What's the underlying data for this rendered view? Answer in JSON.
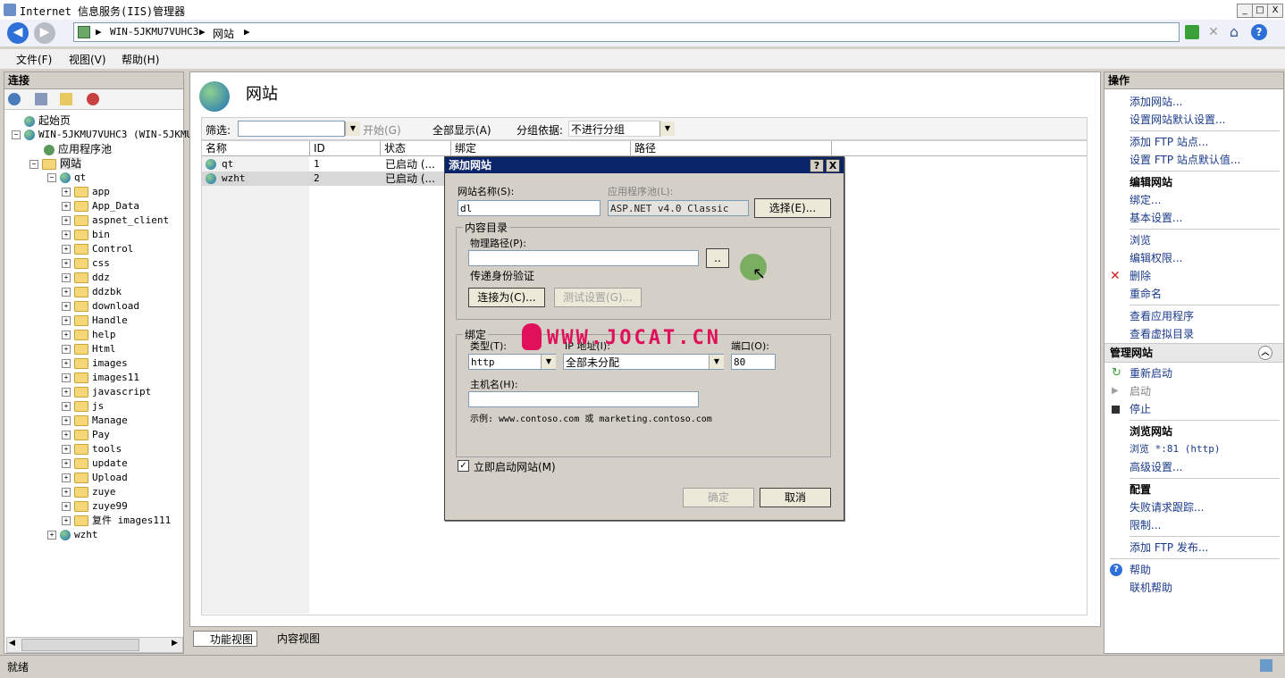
{
  "window": {
    "title": "Internet 信息服务(IIS)管理器",
    "min": "_",
    "max": "□",
    "close": "X"
  },
  "address": {
    "crumbs": [
      "WIN-5JKMU7VUHC3",
      "网站"
    ],
    "sep": "▶"
  },
  "menu": [
    "文件(F)",
    "视图(V)",
    "帮助(H)"
  ],
  "left": {
    "header": "连接",
    "tree": {
      "start": "起始页",
      "server": "WIN-5JKMU7VUHC3 (WIN-5JKMU",
      "apppools": "应用程序池",
      "sites": "网站",
      "qt": "qt",
      "folders": [
        "app",
        "App_Data",
        "aspnet_client",
        "bin",
        "Control",
        "css",
        "ddz",
        "ddzbk",
        "download",
        "Handle",
        "help",
        "Html",
        "images",
        "images11",
        "javascript",
        "js",
        "Manage",
        "Pay",
        "tools",
        "update",
        "Upload",
        "zuye",
        "zuye99",
        "复件 images111"
      ],
      "wzht": "wzht"
    }
  },
  "center": {
    "title": "网站",
    "toolbar": {
      "filter_label": "筛选:",
      "start": "开始(G)",
      "showall": "全部显示(A)",
      "groupby": "分组依据:",
      "group_value": "不进行分组"
    },
    "columns": [
      "名称",
      "ID",
      "状态",
      "绑定",
      "路径"
    ],
    "rows": [
      {
        "name": "qt",
        "id": "1",
        "status": "已启动 (..."
      },
      {
        "name": "wzht",
        "id": "2",
        "status": "已启动 (..."
      }
    ],
    "tabs": [
      "功能视图",
      "内容视图"
    ]
  },
  "dialog": {
    "title": "添加网站",
    "help": "?",
    "close": "X",
    "site_name_label": "网站名称(S):",
    "site_name_value": "dl",
    "apppool_label": "应用程序池(L):",
    "apppool_value": "ASP.NET v4.0 Classic",
    "select_btn": "选择(E)...",
    "content_dir": "内容目录",
    "phys_path_label": "物理路径(P):",
    "phys_path_value": "",
    "browse_btn": "..",
    "pass_auth": "传递身份验证",
    "connect_btn": "连接为(C)...",
    "test_btn": "测试设置(G)...",
    "binding": "绑定",
    "type_label": "类型(T):",
    "type_value": "http",
    "ip_label": "IP 地址(I):",
    "ip_value": "全部未分配",
    "port_label": "端口(O):",
    "port_value": "80",
    "host_label": "主机名(H):",
    "host_value": "",
    "example": "示例: www.contoso.com 或 marketing.contoso.com",
    "start_now": "立即启动网站(M)",
    "ok": "确定",
    "cancel": "取消"
  },
  "watermark": "WWW.JOCAT.CN",
  "right": {
    "header": "操作",
    "actions": {
      "add_site": "添加网站...",
      "site_defaults": "设置网站默认设置...",
      "add_ftp": "添加 FTP 站点...",
      "ftp_defaults": "设置 FTP 站点默认值...",
      "edit_site": "编辑网站",
      "bindings": "绑定...",
      "basic": "基本设置...",
      "browse": "浏览",
      "perms": "编辑权限...",
      "delete": "删除",
      "rename": "重命名",
      "view_apps": "查看应用程序",
      "view_vdirs": "查看虚拟目录",
      "manage_site": "管理网站",
      "restart": "重新启动",
      "start": "启动",
      "stop": "停止",
      "browse_site": "浏览网站",
      "browse_81": "浏览 *:81 (http)",
      "advanced": "高级设置...",
      "config": "配置",
      "failed_req": "失败请求跟踪...",
      "limits": "限制...",
      "add_ftp_pub": "添加 FTP 发布...",
      "help": "帮助",
      "online_help": "联机帮助"
    }
  },
  "status": {
    "text": "就绪"
  },
  "colors": {
    "dialog_title": "#0a246a",
    "link": "#1a3a8a",
    "watermark": "#e0105a"
  }
}
